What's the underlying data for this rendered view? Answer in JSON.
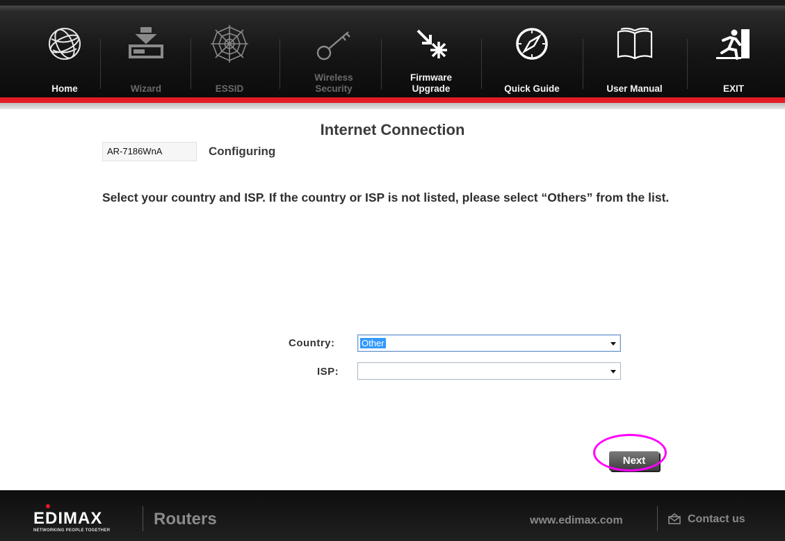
{
  "nav": {
    "items": [
      {
        "label": "Home",
        "icon": "globe-icon",
        "enabled": true
      },
      {
        "label": "Wizard",
        "icon": "install-icon",
        "enabled": false
      },
      {
        "label": "ESSID",
        "icon": "spider-web-icon",
        "enabled": false
      },
      {
        "label": "Wireless\nSecurity",
        "icon": "key-icon",
        "enabled": false
      },
      {
        "label": "Firmware\nUpgrade",
        "icon": "firmware-icon",
        "enabled": true
      },
      {
        "label": "Quick Guide",
        "icon": "compass-icon",
        "enabled": true
      },
      {
        "label": "User Manual",
        "icon": "book-icon",
        "enabled": true
      },
      {
        "label": "EXIT",
        "icon": "exit-icon",
        "enabled": true
      }
    ]
  },
  "main": {
    "title": "Internet Connection",
    "model": "AR-7186WnA",
    "status": "Configuring",
    "instruction": "Select your country and ISP. If the country or ISP is not listed, please select “Others” from the list.",
    "country_label": "Country:",
    "country_value": "Other",
    "isp_label": "ISP:",
    "isp_value": "",
    "next_label": "Next"
  },
  "footer": {
    "brand": "EDIMAX",
    "tagline": "NETWORKING PEOPLE TOGETHER",
    "product": "Routers",
    "website": "www.edimax.com",
    "contact": "Contact us"
  },
  "colors": {
    "accent_red": "#e31b23",
    "highlight_magenta": "#ff00ff",
    "selection_blue": "#3399ff"
  }
}
